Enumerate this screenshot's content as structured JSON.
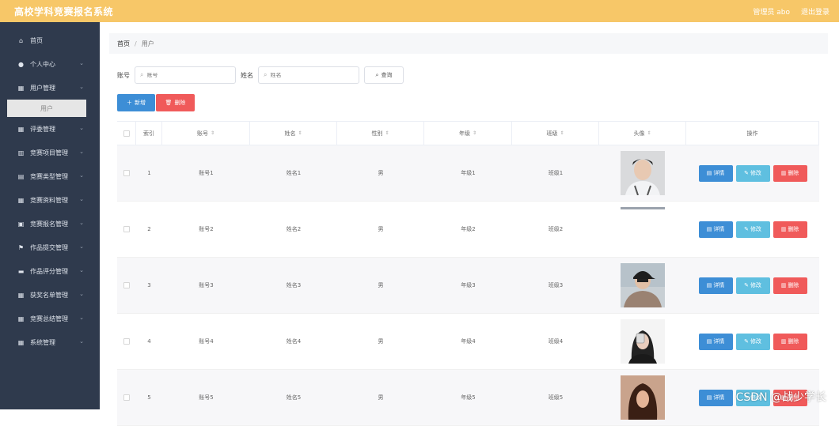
{
  "app": {
    "title": "高校学科竞赛报名系统",
    "user_label": "管理员 abo",
    "logout_label": "退出登录"
  },
  "sidebar": {
    "items": [
      {
        "label": "首页",
        "icon": "home-icon",
        "glyph": "⌂",
        "has_children": false
      },
      {
        "label": "个人中心",
        "icon": "user-icon",
        "glyph": "●",
        "has_children": true
      },
      {
        "label": "用户管理",
        "icon": "grid-icon",
        "glyph": "▦",
        "has_children": true
      },
      {
        "label": "评委管理",
        "icon": "grid-icon",
        "glyph": "▦",
        "has_children": true
      },
      {
        "label": "竞赛项目管理",
        "icon": "bar-chart-icon",
        "glyph": "▥",
        "has_children": true
      },
      {
        "label": "竞赛类型管理",
        "icon": "bank-icon",
        "glyph": "▤",
        "has_children": true
      },
      {
        "label": "竞赛资料管理",
        "icon": "table-icon",
        "glyph": "▦",
        "has_children": true
      },
      {
        "label": "竞赛报名管理",
        "icon": "clipboard-icon",
        "glyph": "▣",
        "has_children": true
      },
      {
        "label": "作品提交管理",
        "icon": "flag-icon",
        "glyph": "⚑",
        "has_children": true
      },
      {
        "label": "作品评分管理",
        "icon": "card-icon",
        "glyph": "▬",
        "has_children": true
      },
      {
        "label": "获奖名单管理",
        "icon": "grid-icon",
        "glyph": "▦",
        "has_children": true
      },
      {
        "label": "竞赛总结管理",
        "icon": "grid-icon",
        "glyph": "▦",
        "has_children": true
      },
      {
        "label": "系统管理",
        "icon": "grid-icon",
        "glyph": "▦",
        "has_children": true
      }
    ],
    "active_sub": "用户"
  },
  "breadcrumb": {
    "home": "首页",
    "separator": "/",
    "current": "用户"
  },
  "search": {
    "account_label": "账号",
    "account_placeholder": "账号",
    "name_label": "姓名",
    "name_placeholder": "姓名",
    "query_label": "查询"
  },
  "actions": {
    "add_label": "新增",
    "delete_label": "删除"
  },
  "table": {
    "headers": {
      "index": "索引",
      "account": "账号",
      "name": "姓名",
      "sex": "性别",
      "grade": "年级",
      "class": "班级",
      "avatar": "头像",
      "ops": "操作"
    },
    "op_labels": {
      "detail": "详情",
      "edit": "修改",
      "delete": "删除"
    },
    "rows": [
      {
        "index": "1",
        "account": "账号1",
        "name": "姓名1",
        "sex": "男",
        "grade": "年级1",
        "class": "班级1",
        "avatar": "photo-man-white"
      },
      {
        "index": "2",
        "account": "账号2",
        "name": "姓名2",
        "sex": "男",
        "grade": "年级2",
        "class": "班级2",
        "avatar": "broken-image"
      },
      {
        "index": "3",
        "account": "账号3",
        "name": "姓名3",
        "sex": "男",
        "grade": "年级3",
        "class": "班级3",
        "avatar": "photo-man-cap"
      },
      {
        "index": "4",
        "account": "账号4",
        "name": "姓名4",
        "sex": "男",
        "grade": "年级4",
        "class": "班级4",
        "avatar": "photo-woman-phone"
      },
      {
        "index": "5",
        "account": "账号5",
        "name": "姓名5",
        "sex": "男",
        "grade": "年级5",
        "class": "班级5",
        "avatar": "photo-woman-hair"
      }
    ]
  },
  "watermark": "CSDN @战少学长"
}
